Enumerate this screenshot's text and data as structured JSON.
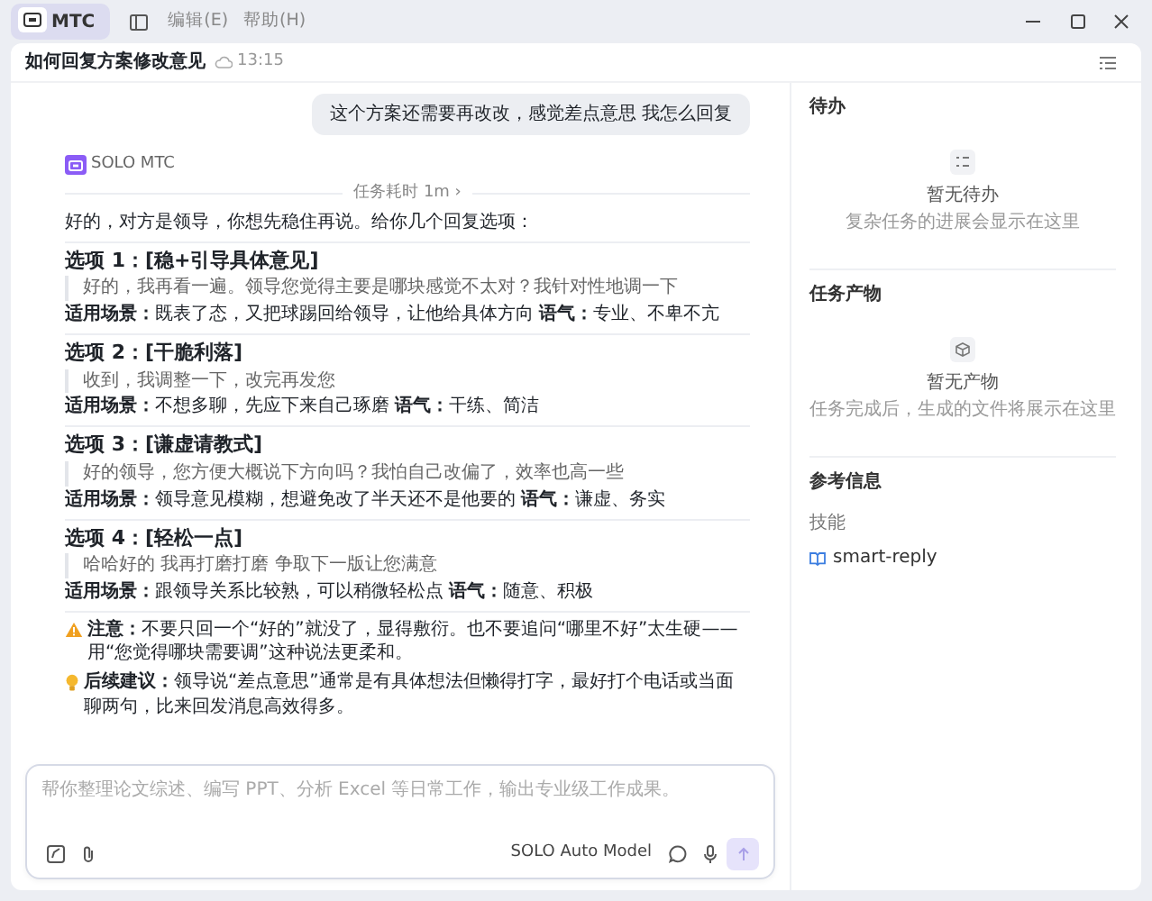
{
  "app_tab": {
    "label": "MTC",
    "selected": true
  },
  "menu": [
    "编辑(E)",
    "帮助(H)"
  ],
  "conversation": {
    "title": "如何回复方案修改意见",
    "time": "13:15"
  },
  "user_message": "这个方案还需要再改改，感觉差点意思 我怎么回复",
  "assistant": {
    "name": "SOLO MTC",
    "duration": "任务耗时 1m ›",
    "intro": "好的，对方是领导，你想先稳住再说。给你几个回复选项：",
    "options": [
      {
        "title": "选项 1：[稳+引导具体意见]",
        "quote": "好的，我再看一遍。领导您觉得主要是哪块感觉不太对？我针对性地调一下",
        "usage": "**适用场景：**既表了态，又把球踢回给领导，让他给具体方向 **语气：**专业、不卑不亢"
      },
      {
        "title": "选项 2：[干脆利落]",
        "quote": "收到，我调整一下，改完再发您",
        "usage": "**适用场景：**不想多聊，先应下来自己琢磨 **语气：**干练、简洁"
      },
      {
        "title": "选项 3：[谦虚请教式]",
        "quote": "好的领导，您方便大概说下方向吗？我怕自己改偏了，效率也高一些",
        "usage": "**适用场景：**领导意见模糊，想避免改了半天还不是他要的 **语气：**谦虚、务实"
      },
      {
        "title": "选项 4：[轻松一点]",
        "quote": "哈哈好的 我再打磨打磨 争取下一版让您满意",
        "usage": "**适用场景：**跟领导关系比较熟，可以稍微轻松点 **语气：**随意、积极"
      }
    ],
    "notes": [
      {
        "kind": "warning",
        "text": "**注意：**不要只回一个“好的”就没了，显得敷衍。也不要追问“哪里不好”太生硬——用“您觉得哪块需要调”这种说法更柔和。"
      },
      {
        "kind": "tip",
        "text": "**后续建议：**领导说“差点意思”通常是有具体想法但懒得打字，最好打个电话或当面聊两句，比来回发消息高效得多。"
      }
    ]
  },
  "composer": {
    "placeholder": "帮你整理论文综述、编写 PPT、分析 Excel 等日常工作，输出专业级工作成果。",
    "model": "SOLO Auto Model"
  },
  "side_panel": [
    {
      "kind": "empty",
      "title": "待办",
      "empty_title": "暂无待办",
      "empty_text": "复杂任务的进展会显示在这里"
    },
    {
      "kind": "empty",
      "title": "任务产物",
      "empty_title": "暂无产物",
      "empty_text": "任务完成后，生成的文件将展示在这里"
    },
    {
      "kind": "reference",
      "title": "参考信息",
      "group": "技能",
      "items": [
        "smart-reply"
      ]
    }
  ]
}
